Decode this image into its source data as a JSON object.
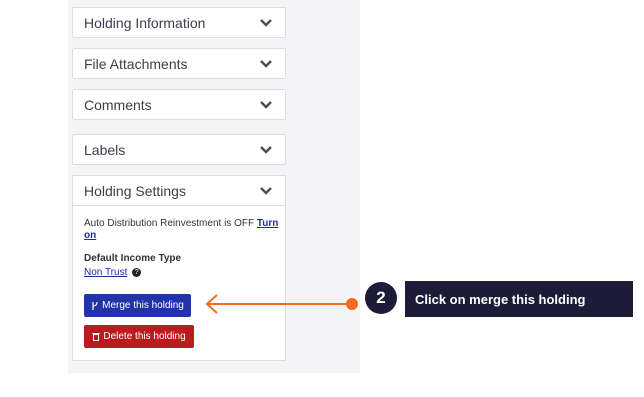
{
  "sections": [
    {
      "label": "Holding Information"
    },
    {
      "label": "File Attachments"
    },
    {
      "label": "Comments"
    },
    {
      "label": "Labels"
    },
    {
      "label": "Holding Settings"
    }
  ],
  "settings": {
    "auto_text": "Auto Distribution Reinvestment is OFF",
    "turn_on_link": "Turn on",
    "income_type_label": "Default Income Type",
    "income_type_value": "Non Trust",
    "help_glyph": "?"
  },
  "buttons": {
    "merge_label": "Merge this holding",
    "delete_label": "Delete this holding"
  },
  "callout": {
    "step_number": "2",
    "text": "Click on merge this holding",
    "color": "#f26b21"
  },
  "icons": {
    "chevron": "chevron-down-icon",
    "merge": "merge-icon",
    "trash": "trash-icon",
    "help": "question-circle-icon"
  }
}
